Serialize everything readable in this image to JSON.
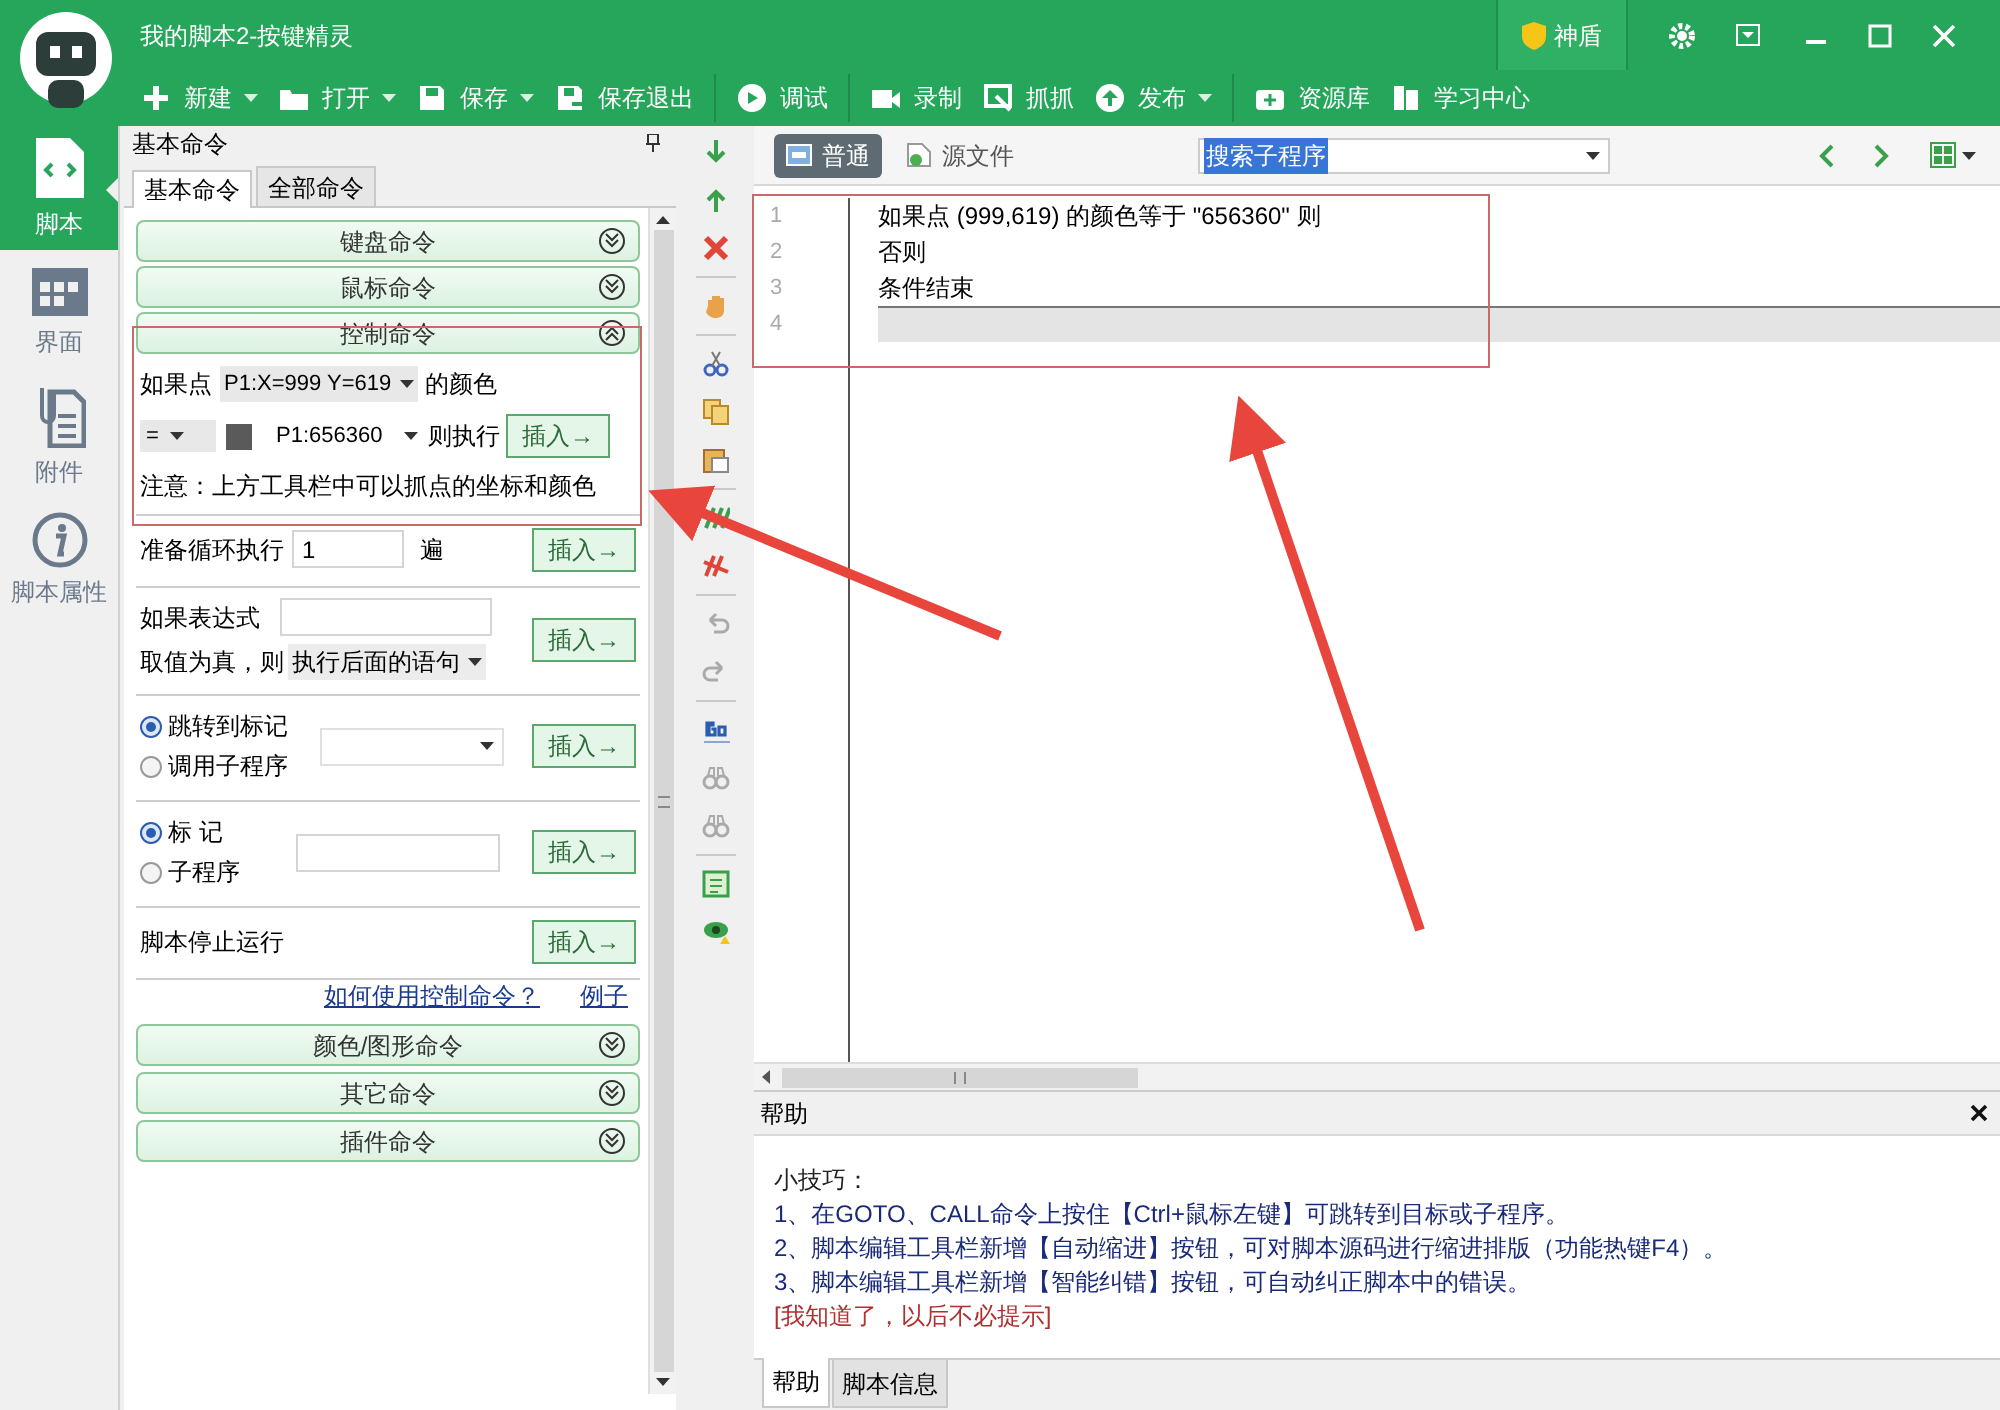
{
  "window": {
    "title": "我的脚本2-按键精灵",
    "shield_label": "神盾"
  },
  "toolbar": [
    {
      "label": "新建",
      "dropdown": true,
      "separator_after": false
    },
    {
      "label": "打开",
      "dropdown": true,
      "separator_after": false
    },
    {
      "label": "保存",
      "dropdown": true,
      "separator_after": false
    },
    {
      "label": "保存退出",
      "dropdown": false,
      "separator_after": true
    },
    {
      "label": "调试",
      "dropdown": false,
      "separator_after": true
    },
    {
      "label": "录制",
      "dropdown": false,
      "separator_after": false
    },
    {
      "label": "抓抓",
      "dropdown": false,
      "separator_after": false
    },
    {
      "label": "发布",
      "dropdown": true,
      "separator_after": true
    },
    {
      "label": "资源库",
      "dropdown": false,
      "separator_after": false
    },
    {
      "label": "学习中心",
      "dropdown": false,
      "separator_after": false
    }
  ],
  "sidebar": {
    "items": [
      {
        "label": "脚本",
        "selected": true
      },
      {
        "label": "界面",
        "selected": false
      },
      {
        "label": "附件",
        "selected": false
      },
      {
        "label": "脚本属性",
        "selected": false
      }
    ]
  },
  "command_panel": {
    "title": "基本命令",
    "tabs": [
      {
        "label": "基本命令",
        "selected": true
      },
      {
        "label": "全部命令",
        "selected": false
      }
    ],
    "groups_before": [
      {
        "label": "键盘命令",
        "expanded": false
      },
      {
        "label": "鼠标命令",
        "expanded": false
      },
      {
        "label": "控制命令",
        "expanded": true
      }
    ],
    "color_condition": {
      "prefix": "如果点",
      "point": "P1:X=999 Y=619",
      "suffix": "的颜色",
      "operator": "=",
      "color_reading": "P1:656360",
      "then": "则执行",
      "insert": "插入→",
      "note": "注意：上方工具栏中可以抓点的坐标和颜色"
    },
    "rows": [
      {
        "kind": "loop",
        "label": "准备循环执行",
        "value": "1",
        "unit": "遍",
        "insert": "插入→"
      },
      {
        "kind": "expression",
        "label": "如果表达式",
        "label_2": "取值为真，则",
        "select": "执行后面的语句",
        "insert": "插入→"
      },
      {
        "kind": "radio_dropdown",
        "options": [
          {
            "label": "跳转到标记",
            "selected": true
          },
          {
            "label": "调用子程序",
            "selected": false
          }
        ],
        "insert": "插入→"
      },
      {
        "kind": "radio_text",
        "options": [
          {
            "label": "标 记",
            "selected": true
          },
          {
            "label": "子程序",
            "selected": false
          }
        ],
        "insert": "插入→"
      },
      {
        "kind": "plain",
        "label": "脚本停止运行",
        "insert": "插入→"
      }
    ],
    "links": [
      "如何使用控制命令？",
      "例子"
    ],
    "groups_after": [
      {
        "label": "颜色/图形命令",
        "expanded": false
      },
      {
        "label": "其它命令",
        "expanded": false
      },
      {
        "label": "插件命令",
        "expanded": false
      }
    ]
  },
  "editor": {
    "tabs": [
      {
        "label": "普通",
        "selected": true
      },
      {
        "label": "源文件",
        "selected": false
      }
    ],
    "search": {
      "value": "搜索子程序"
    },
    "lines": [
      {
        "number": "1",
        "text": "如果点 (999,619) 的颜色等于 \"656360\" 则",
        "current": false
      },
      {
        "number": "2",
        "text": "否则",
        "current": false
      },
      {
        "number": "3",
        "text": "条件结束",
        "current": false
      },
      {
        "number": "4",
        "current": true
      }
    ]
  },
  "help": {
    "title": "帮助",
    "heading": "小技巧：",
    "tips": [
      "1、在GOTO、CALL命令上按住【Ctrl+鼠标左键】可跳转到目标或子程序。",
      "2、脚本编辑工具栏新增【自动缩进】按钮，可对脚本源码进行缩进排版（功能热键F4）。",
      "3、脚本编辑工具栏新增【智能纠错】按钮，可自动纠正脚本中的错误。"
    ],
    "dismiss": "[我知道了，以后不必提示]",
    "tabs": [
      {
        "label": "帮助",
        "selected": true
      },
      {
        "label": "脚本信息",
        "selected": false
      }
    ]
  }
}
